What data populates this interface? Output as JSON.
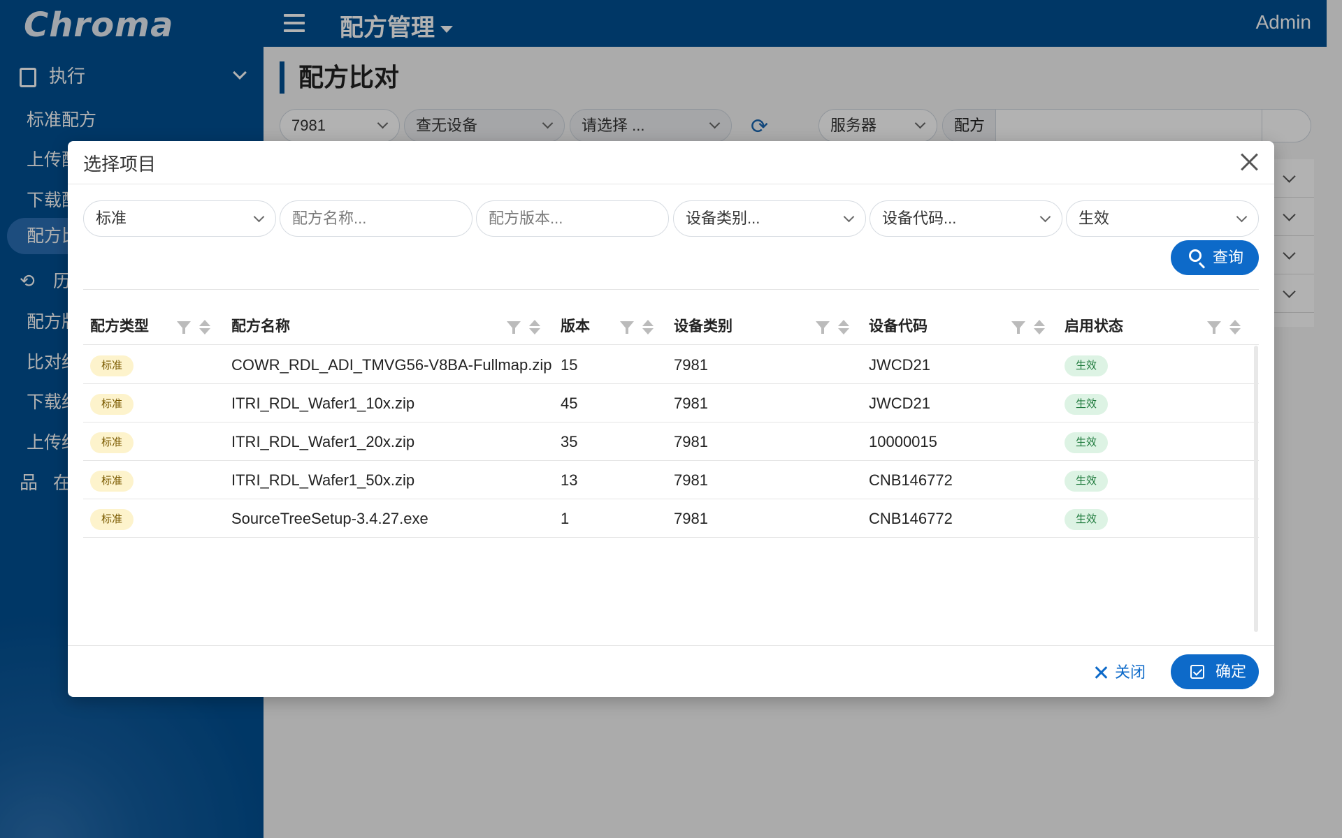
{
  "header": {
    "logo": "Chroma",
    "module": "配方管理",
    "user": "Admin"
  },
  "sidebar": {
    "group_label": "执行",
    "items": [
      {
        "label": "标准配方"
      },
      {
        "label": "上传配"
      },
      {
        "label": "下载配"
      },
      {
        "label": "配方比"
      },
      {
        "label": "历",
        "icon": "history-icon"
      },
      {
        "label": "配方版"
      },
      {
        "label": "比对结"
      },
      {
        "label": "下载结"
      },
      {
        "label": "上传结"
      },
      {
        "label": "在",
        "icon": "network-icon"
      }
    ]
  },
  "page": {
    "title": "配方比对",
    "filters": {
      "device_type": "7981",
      "device": "查无设备",
      "choose": "请选择 ...",
      "server": "服务器",
      "recipe_label": "配方"
    }
  },
  "modal": {
    "title": "选择项目",
    "filters": {
      "recipe_type": "标准",
      "recipe_name_placeholder": "配方名称...",
      "recipe_version_placeholder": "配方版本...",
      "device_category_placeholder": "设备类别...",
      "device_code_placeholder": "设备代码...",
      "status": "生效"
    },
    "query_label": "查询",
    "columns": [
      "配方类型",
      "配方名称",
      "版本",
      "设备类别",
      "设备代码",
      "启用状态"
    ],
    "rows": [
      {
        "type": "标准",
        "name": "COWR_RDL_ADI_TMVG56-V8BA-Fullmap.zip",
        "version": "15",
        "category": "7981",
        "code": "JWCD21",
        "status": "生效"
      },
      {
        "type": "标准",
        "name": "ITRI_RDL_Wafer1_10x.zip",
        "version": "45",
        "category": "7981",
        "code": "JWCD21",
        "status": "生效"
      },
      {
        "type": "标准",
        "name": "ITRI_RDL_Wafer1_20x.zip",
        "version": "35",
        "category": "7981",
        "code": "10000015",
        "status": "生效"
      },
      {
        "type": "标准",
        "name": "ITRI_RDL_Wafer1_50x.zip",
        "version": "13",
        "category": "7981",
        "code": "CNB146772",
        "status": "生效"
      },
      {
        "type": "标准",
        "name": "SourceTreeSetup-3.4.27.exe",
        "version": "1",
        "category": "7981",
        "code": "CNB146772",
        "status": "生效"
      }
    ],
    "cancel_label": "关闭",
    "ok_label": "确定"
  }
}
